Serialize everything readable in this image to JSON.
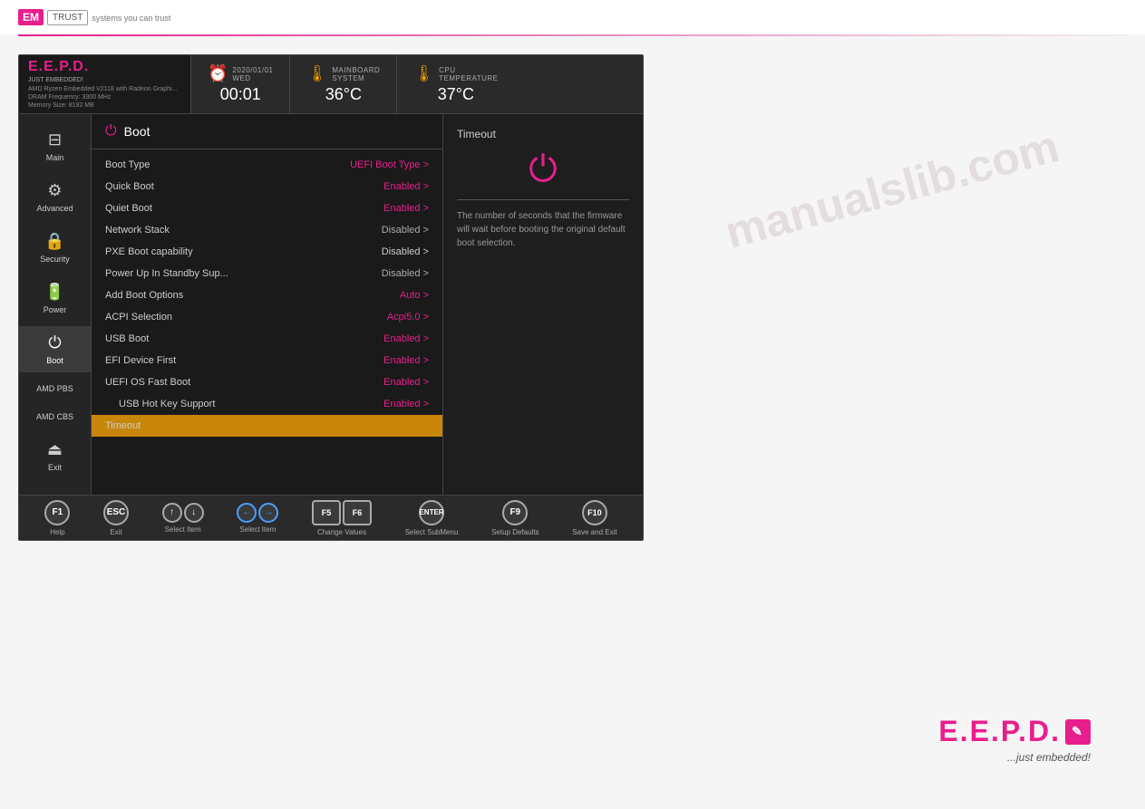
{
  "header": {
    "em_label": "EM",
    "trust_label": "TRUST",
    "subtitle": "systems you can trust"
  },
  "bios": {
    "logo": {
      "text": "E.E.P.D.",
      "sub": "JUST EMBEDDED!",
      "details_line1": "AMD Ryzen Embedded V2118 with Radeon Graphi...",
      "details_line2": "DRAM Frequency: 3300 MHz",
      "details_line3": "Memory Size: 8192 MB"
    },
    "date_label": "2020/01/01",
    "day_label": "WED",
    "time_value": "00:01",
    "mainboard_label": "MAINBOARD",
    "system_label": "SYSTEM",
    "mainboard_temp": "36°C",
    "cpu_label": "CPU",
    "temperature_label": "TEMPERATURE",
    "cpu_temp": "37°C",
    "nav": {
      "items": [
        {
          "id": "main",
          "label": "Main",
          "icon": "⊟"
        },
        {
          "id": "advanced",
          "label": "Advanced",
          "icon": "⚙"
        },
        {
          "id": "security",
          "label": "Security",
          "icon": "🔒"
        },
        {
          "id": "power",
          "label": "Power",
          "icon": "🔋"
        },
        {
          "id": "boot",
          "label": "Boot",
          "icon": "⏻"
        },
        {
          "id": "amd_pbs",
          "label": "AMD PBS",
          "icon": ""
        },
        {
          "id": "amd_cbs",
          "label": "AMD CBS",
          "icon": ""
        },
        {
          "id": "exit",
          "label": "Exit",
          "icon": "⏏"
        }
      ]
    },
    "boot_title": "Boot",
    "boot_options": [
      {
        "label": "Boot Type",
        "value": "UEFI Boot Type >",
        "type": "uefi"
      },
      {
        "label": "Quick Boot",
        "value": "Enabled >",
        "type": "enabled"
      },
      {
        "label": "Quiet Boot",
        "value": "Enabled >",
        "type": "enabled"
      },
      {
        "label": "Network Stack",
        "value": "Disabled >",
        "type": "disabled"
      },
      {
        "label": "PXE Boot capability",
        "value": "Disabled >",
        "type": "plain"
      },
      {
        "label": "Power Up In Standby Sup...",
        "value": "Disabled >",
        "type": "disabled"
      },
      {
        "label": "Add Boot Options",
        "value": "Auto >",
        "type": "auto"
      },
      {
        "label": "ACPI Selection",
        "value": "Acpi5.0 >",
        "type": "acpi"
      },
      {
        "label": "USB Boot",
        "value": "Enabled >",
        "type": "enabled"
      },
      {
        "label": "EFI Device First",
        "value": "Enabled >",
        "type": "enabled"
      },
      {
        "label": "UEFI OS Fast Boot",
        "value": "Enabled >",
        "type": "enabled"
      },
      {
        "label": "USB Hot Key Support",
        "value": "Enabled >",
        "type": "enabled",
        "indented": true
      },
      {
        "label": "Timeout",
        "value": "",
        "type": "highlighted",
        "highlighted": true
      }
    ],
    "info_panel": {
      "title": "Timeout",
      "description": "The number of seconds that the firmware will wait before booting the original default boot selection."
    },
    "footer": {
      "keys": [
        {
          "label": "Help",
          "key": "F1"
        },
        {
          "label": "Exit",
          "key": "ESC"
        },
        {
          "label": "Select Item",
          "arrows": [
            "↑",
            "↓"
          ]
        },
        {
          "label": "Select Item",
          "arrows": [
            "←",
            "→"
          ]
        },
        {
          "label": "Change Values",
          "double": [
            "F5",
            "F6"
          ]
        },
        {
          "label": "Select SubMenu",
          "key": "ENTER"
        },
        {
          "label": "Setup Defaults",
          "key": "F9"
        },
        {
          "label": "Save and Exit",
          "key": "F10"
        }
      ]
    }
  },
  "watermark": {
    "text": "manualslib.com"
  },
  "bottom_logo": {
    "text": "E.E.P.D.",
    "tagline": "...just embedded!"
  }
}
